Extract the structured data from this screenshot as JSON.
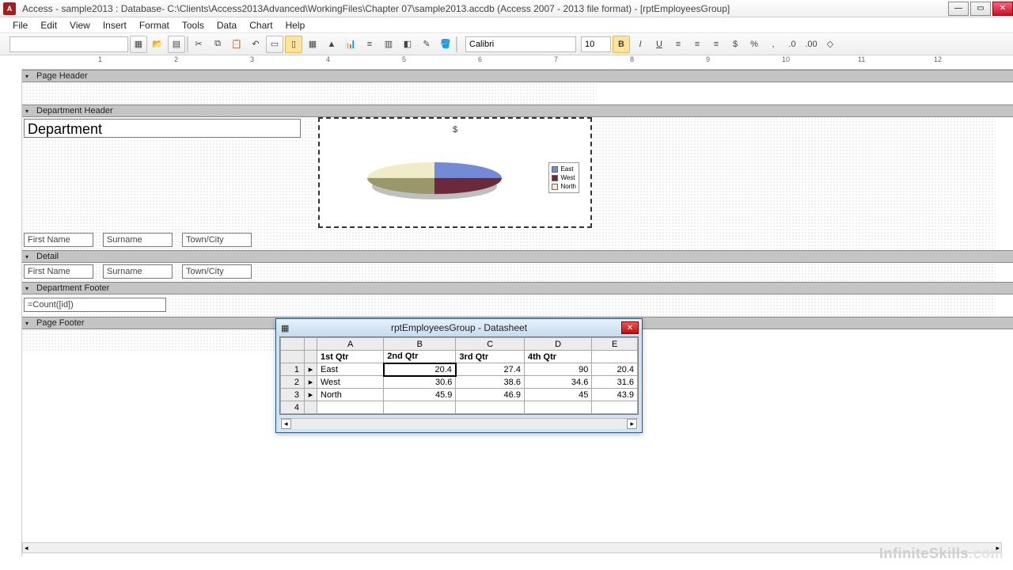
{
  "title": "Access - sample2013 : Database- C:\\Clients\\Access2013Advanced\\WorkingFiles\\Chapter 07\\sample2013.accdb (Access 2007 - 2013 file format) - [rptEmployeesGroup]",
  "menu": [
    "File",
    "Edit",
    "View",
    "Insert",
    "Format",
    "Tools",
    "Data",
    "Chart",
    "Help"
  ],
  "font": {
    "name": "Calibri",
    "size": "10"
  },
  "sections": {
    "page_header": "Page Header",
    "dept_header": "Department Header",
    "detail": "Detail",
    "dept_footer": "Department Footer",
    "page_footer": "Page Footer"
  },
  "labels": {
    "department": "Department",
    "first_name": "First Name",
    "surname": "Surname",
    "town_city": "Town/City",
    "count": "=Count([id])"
  },
  "chart": {
    "title": "$",
    "legend": [
      "East",
      "West",
      "North"
    ]
  },
  "chart_data": {
    "type": "pie",
    "title": "$",
    "categories": [
      "East",
      "West",
      "North"
    ],
    "series": [
      {
        "name": "1st Qtr",
        "values": [
          20.4,
          30.6,
          45.9
        ]
      },
      {
        "name": "2nd Qtr",
        "values": [
          27.4,
          38.6,
          46.9
        ]
      },
      {
        "name": "3rd Qtr",
        "values": [
          90,
          34.6,
          45
        ]
      },
      {
        "name": "4th Qtr",
        "values": [
          20.4,
          31.6,
          43.9
        ]
      }
    ],
    "note": "Pie currently showing first quarter distribution across regions"
  },
  "datasheet": {
    "title": "rptEmployeesGroup - Datasheet",
    "cols": [
      "A",
      "B",
      "C",
      "D",
      "E"
    ],
    "headers": [
      "1st Qtr",
      "2nd Qtr",
      "3rd Qtr",
      "4th Qtr"
    ],
    "rows": [
      {
        "n": "1",
        "region": "East",
        "v": [
          "20.4",
          "27.4",
          "90",
          "20.4"
        ]
      },
      {
        "n": "2",
        "region": "West",
        "v": [
          "30.6",
          "38.6",
          "34.6",
          "31.6"
        ]
      },
      {
        "n": "3",
        "region": "North",
        "v": [
          "45.9",
          "46.9",
          "45",
          "43.9"
        ]
      },
      {
        "n": "4",
        "region": "",
        "v": [
          "",
          "",
          "",
          ""
        ]
      }
    ]
  },
  "watermark": {
    "brand": "InfiniteSkills",
    "ext": ".com"
  }
}
